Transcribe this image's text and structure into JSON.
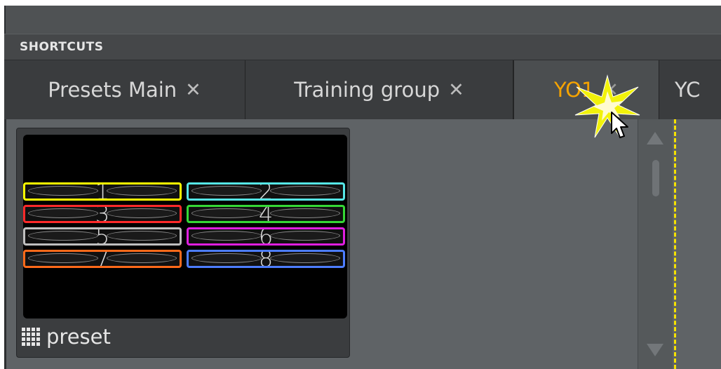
{
  "header": {
    "section_title": "SHORTCUTS"
  },
  "tabs": [
    {
      "label": "Presets Main",
      "close": "✕",
      "active": false
    },
    {
      "label": "Training group",
      "close": "✕",
      "active": false
    },
    {
      "label": "YO1",
      "close": "✕",
      "active": true
    },
    {
      "label": "YC",
      "close": "",
      "active": false
    }
  ],
  "preset": {
    "label": "preset",
    "slots": [
      {
        "number": "1",
        "color": "#ffff00"
      },
      {
        "number": "2",
        "color": "#55e6e6"
      },
      {
        "number": "3",
        "color": "#ff2a2a"
      },
      {
        "number": "4",
        "color": "#35d835"
      },
      {
        "number": "5",
        "color": "#bfbfbf"
      },
      {
        "number": "6",
        "color": "#e01ee0"
      },
      {
        "number": "7",
        "color": "#ff6a1a"
      },
      {
        "number": "8",
        "color": "#4d7dff"
      }
    ]
  },
  "colors": {
    "active_tab_text": "#f5a300",
    "dashed_line": "#f5e200"
  }
}
